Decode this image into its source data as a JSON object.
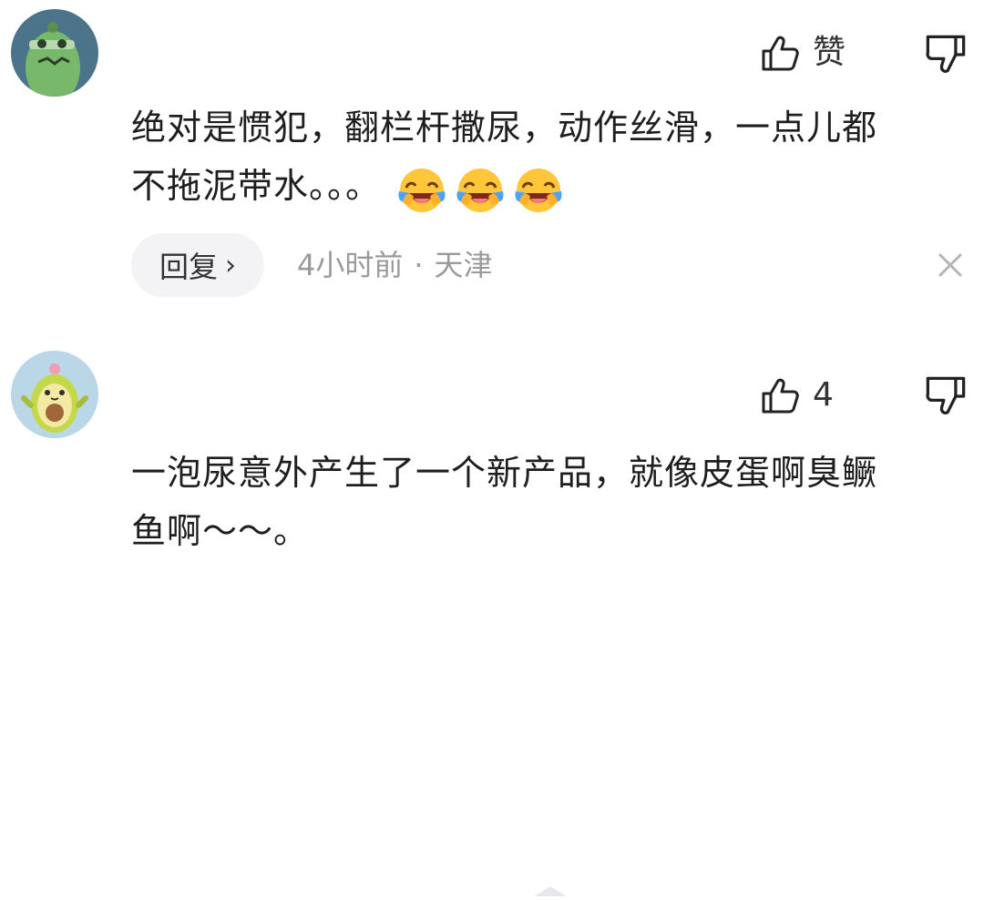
{
  "comments": [
    {
      "username": "",
      "avatar": "green-monster-avatar",
      "like_label": "赞",
      "content_lines": [
        "绝对是惯犯，翻栏杆撒尿，动作丝滑，一点儿都",
        "不拖泥带水。。。"
      ],
      "emojis": [
        "laughing-crying-face",
        "laughing-crying-face",
        "laughing-crying-face"
      ],
      "reply_label": "回复",
      "time": "4小时前",
      "location": "天津",
      "separator": "·"
    },
    {
      "username": "",
      "avatar": "avocado-avatar",
      "like_count": "4",
      "content_lines": [
        "一泡尿意外产生了一个新产品，就像皮蛋啊臭鳜",
        "鱼啊～～。"
      ]
    }
  ],
  "colors": {
    "text": "#1e1e1e",
    "meta": "#9a9a9a",
    "reply_bg": "#f3f3f5",
    "icon": "#222222"
  },
  "icons": [
    "thumbs-up-icon",
    "thumbs-down-icon",
    "close-icon",
    "chevron-right-icon",
    "laughing-crying-face"
  ]
}
